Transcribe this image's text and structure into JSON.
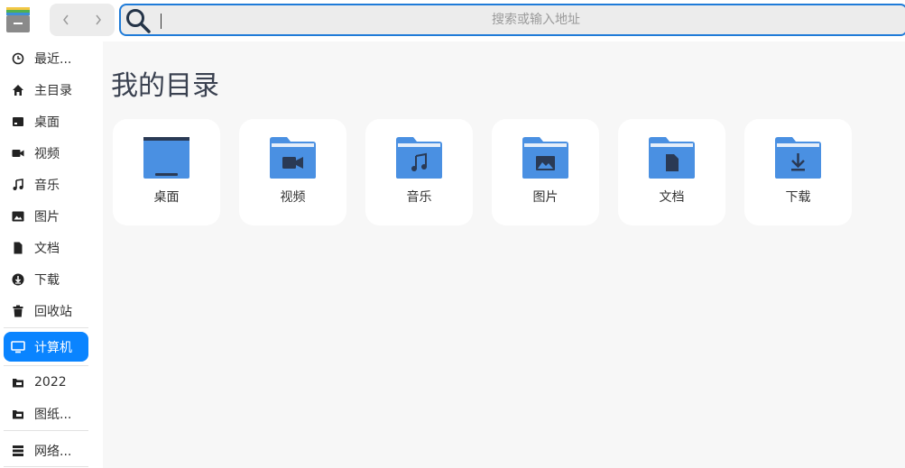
{
  "toolbar": {
    "app_icon": "file-manager-icon",
    "back_icon": "chevron-left-icon",
    "forward_icon": "chevron-right-icon"
  },
  "search": {
    "icon": "search-icon",
    "value": "",
    "placeholder": "搜索或输入地址"
  },
  "sidebar": {
    "items": [
      {
        "label": "最近...",
        "icon": "clock-icon"
      },
      {
        "label": "主目录",
        "icon": "home-icon"
      },
      {
        "label": "桌面",
        "icon": "desktop-icon"
      },
      {
        "label": "视频",
        "icon": "video-icon"
      },
      {
        "label": "音乐",
        "icon": "music-icon"
      },
      {
        "label": "图片",
        "icon": "image-icon"
      },
      {
        "label": "文档",
        "icon": "document-icon"
      },
      {
        "label": "下载",
        "icon": "download-icon"
      },
      {
        "label": "回收站",
        "icon": "trash-icon"
      },
      {
        "label": "计算机",
        "icon": "computer-icon",
        "active": true
      },
      {
        "label": "2022",
        "icon": "drive-icon"
      },
      {
        "label": "图纸...",
        "icon": "drive-icon"
      },
      {
        "label": "网络...",
        "icon": "network-icon"
      }
    ]
  },
  "main": {
    "title": "我的目录",
    "tiles": [
      {
        "label": "桌面",
        "icon": "desktop-folder-icon"
      },
      {
        "label": "视频",
        "icon": "video-folder-icon"
      },
      {
        "label": "音乐",
        "icon": "music-folder-icon"
      },
      {
        "label": "图片",
        "icon": "pictures-folder-icon"
      },
      {
        "label": "文档",
        "icon": "documents-folder-icon"
      },
      {
        "label": "下载",
        "icon": "downloads-folder-icon"
      }
    ]
  },
  "colors": {
    "accent": "#0a84ff",
    "folder_blue": "#4a90e2",
    "folder_dark": "#2a3a55",
    "search_border": "#1f7bd8"
  }
}
